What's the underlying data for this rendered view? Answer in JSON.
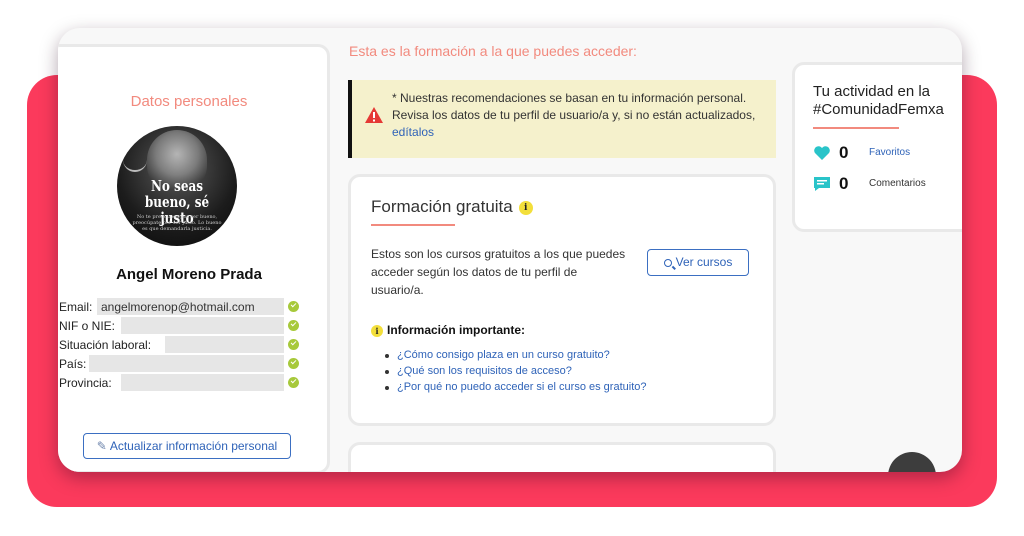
{
  "left": {
    "title": "Datos personales",
    "avatar": {
      "line1": "No seas",
      "line2": "bueno, sé justo",
      "small_text": "No te preocupes por ser bueno, preocúpate por ser justo. Lo bueno es que demandarla justicia."
    },
    "name": "Angel Moreno Prada",
    "fields": [
      {
        "label": "Email:",
        "value": "angelmorenop@hotmail.com"
      },
      {
        "label": "NIF o NIE:",
        "value": ""
      },
      {
        "label": "Situación laboral:",
        "value": ""
      },
      {
        "label": "País:",
        "value": ""
      },
      {
        "label": "Provincia:",
        "value": ""
      }
    ],
    "update_button": "Actualizar información personal"
  },
  "main": {
    "heading": "Esta es la formación a la que puedes acceder:",
    "alert": {
      "line1": "* Nuestras recomendaciones se basan en tu información personal.",
      "line2": "Revisa los datos de tu perfil de usuario/a y, si no están actualizados,",
      "link": "edítalos"
    },
    "free": {
      "title": "Formación gratuita",
      "badge": "i",
      "desc": "Estos son los cursos gratuitos a los que puedes acceder según los datos de tu perfil de usuario/a.",
      "button": "Ver cursos",
      "important_title": "Información importante:",
      "links": [
        "¿Cómo consigo plaza en un curso gratuito?",
        "¿Qué son los requisitos de acceso?",
        "¿Por qué no puedo acceder si el curso es gratuito?"
      ]
    }
  },
  "right": {
    "title_line1": "Tu actividad en la",
    "title_line2": "#ComunidadFemxa",
    "stats": [
      {
        "icon": "heart-icon",
        "count": "0",
        "label": "Favoritos"
      },
      {
        "icon": "comment-icon",
        "count": "0",
        "label": "Comentarios"
      }
    ]
  },
  "colors": {
    "accent_red": "#fb3a5c",
    "salmon": "#f28a7e",
    "link_blue": "#2f63b8",
    "alert_bg": "#f5f1cc",
    "teal": "#29c4c9",
    "check_green": "#a7c93b"
  }
}
